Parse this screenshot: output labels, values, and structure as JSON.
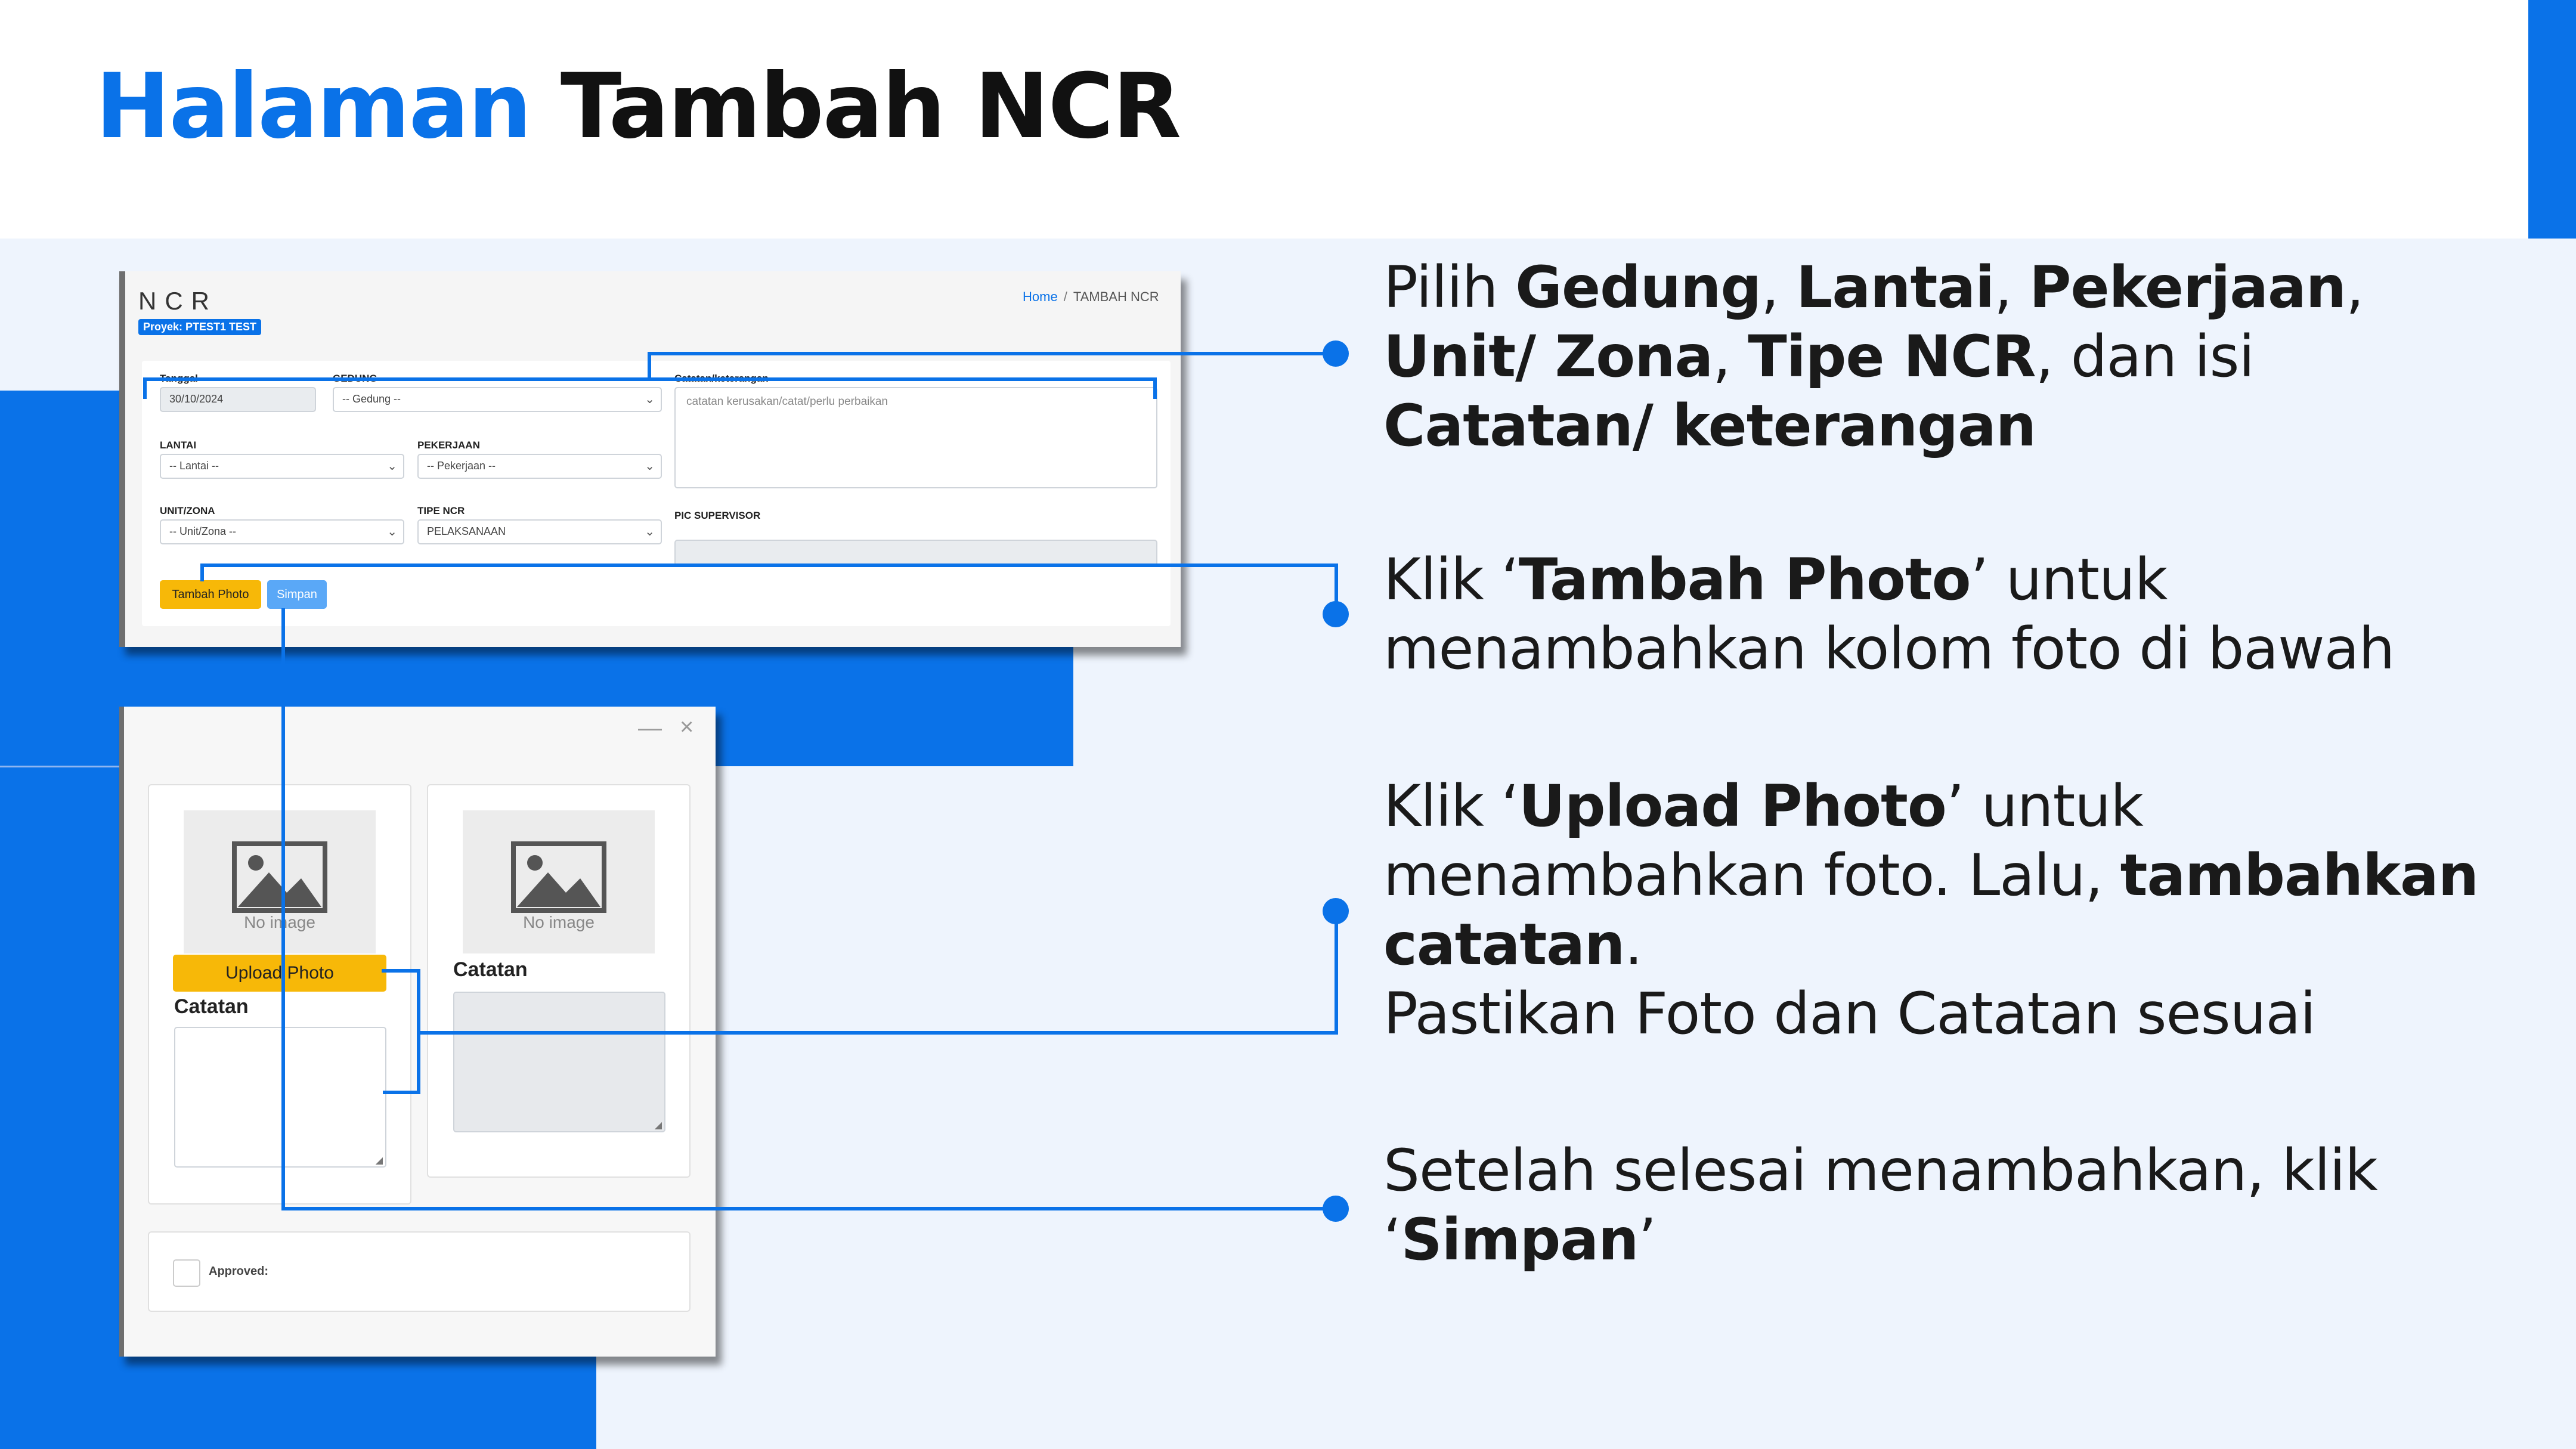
{
  "slide": {
    "title_highlight": "Halaman",
    "title_rest": "Tambah NCR"
  },
  "ncr_form": {
    "brand": "NCR",
    "project_badge": "Proyek: PTEST1 TEST",
    "breadcrumb": {
      "home": "Home",
      "separator": "/",
      "current": "TAMBAH NCR"
    },
    "tanggal_label": "Tanggal",
    "tanggal_value": "30/10/2024",
    "gedung_label": "GEDUNG",
    "gedung_value": "-- Gedung --",
    "catatan_label": "Catatan/keterangan",
    "catatan_placeholder": "catatan kerusakan/catat/perlu perbaikan",
    "lantai_label": "LANTAI",
    "lantai_value": "-- Lantai --",
    "pekerjaan_label": "PEKERJAAN",
    "pekerjaan_value": "-- Pekerjaan --",
    "unit_label": "UNIT/ZONA",
    "unit_value": "-- Unit/Zona --",
    "tipe_label": "TIPE NCR",
    "tipe_value": "PELAKSANAAN",
    "pic_label": "PIC SUPERVISOR",
    "tambah_photo_button": "Tambah Photo",
    "simpan_button": "Simpan"
  },
  "photo_panel": {
    "minimize": "—",
    "close": "×",
    "cards": [
      {
        "no_image": "No image",
        "upload_button": "Upload Photo",
        "catatan_label": "Catatan"
      },
      {
        "no_image": "No image",
        "catatan_label": "Catatan"
      }
    ],
    "approved_label": "Approved:"
  },
  "steps": {
    "s1": {
      "t1": "Pilih ",
      "b1": "Gedung",
      "t2": ", ",
      "b2": "Lantai",
      "t3": ", ",
      "b3": "Pekerjaan",
      "t4": ", ",
      "b4": "Unit/ Zona",
      "t5": ", ",
      "b5": "Tipe NCR",
      "t6": ", dan isi ",
      "b6": "Catatan/ keterangan"
    },
    "s2": {
      "t1": "Klik ‘",
      "b1": "Tambah Photo",
      "t2": "’ untuk menambahkan kolom foto di bawah"
    },
    "s3": {
      "t1": "Klik ‘",
      "b1": "Upload Photo",
      "t2": "’ untuk menambahkan foto. Lalu, ",
      "b2": "tambahkan catatan",
      "t3": ".",
      "line2": "Pastikan Foto dan Catatan sesuai"
    },
    "s4": {
      "t1": "Setelah selesai menambahkan, klik ‘",
      "b1": "Simpan",
      "t2": "’"
    }
  },
  "colors": {
    "accent": "#0a72e8",
    "background": "#eef4fd",
    "button_yellow": "#f7b808",
    "button_blue": "#5aa8f7"
  },
  "icons": [
    "image-placeholder-icon",
    "chevron-down-icon",
    "minimize-icon",
    "close-icon",
    "resize-handle-icon"
  ]
}
